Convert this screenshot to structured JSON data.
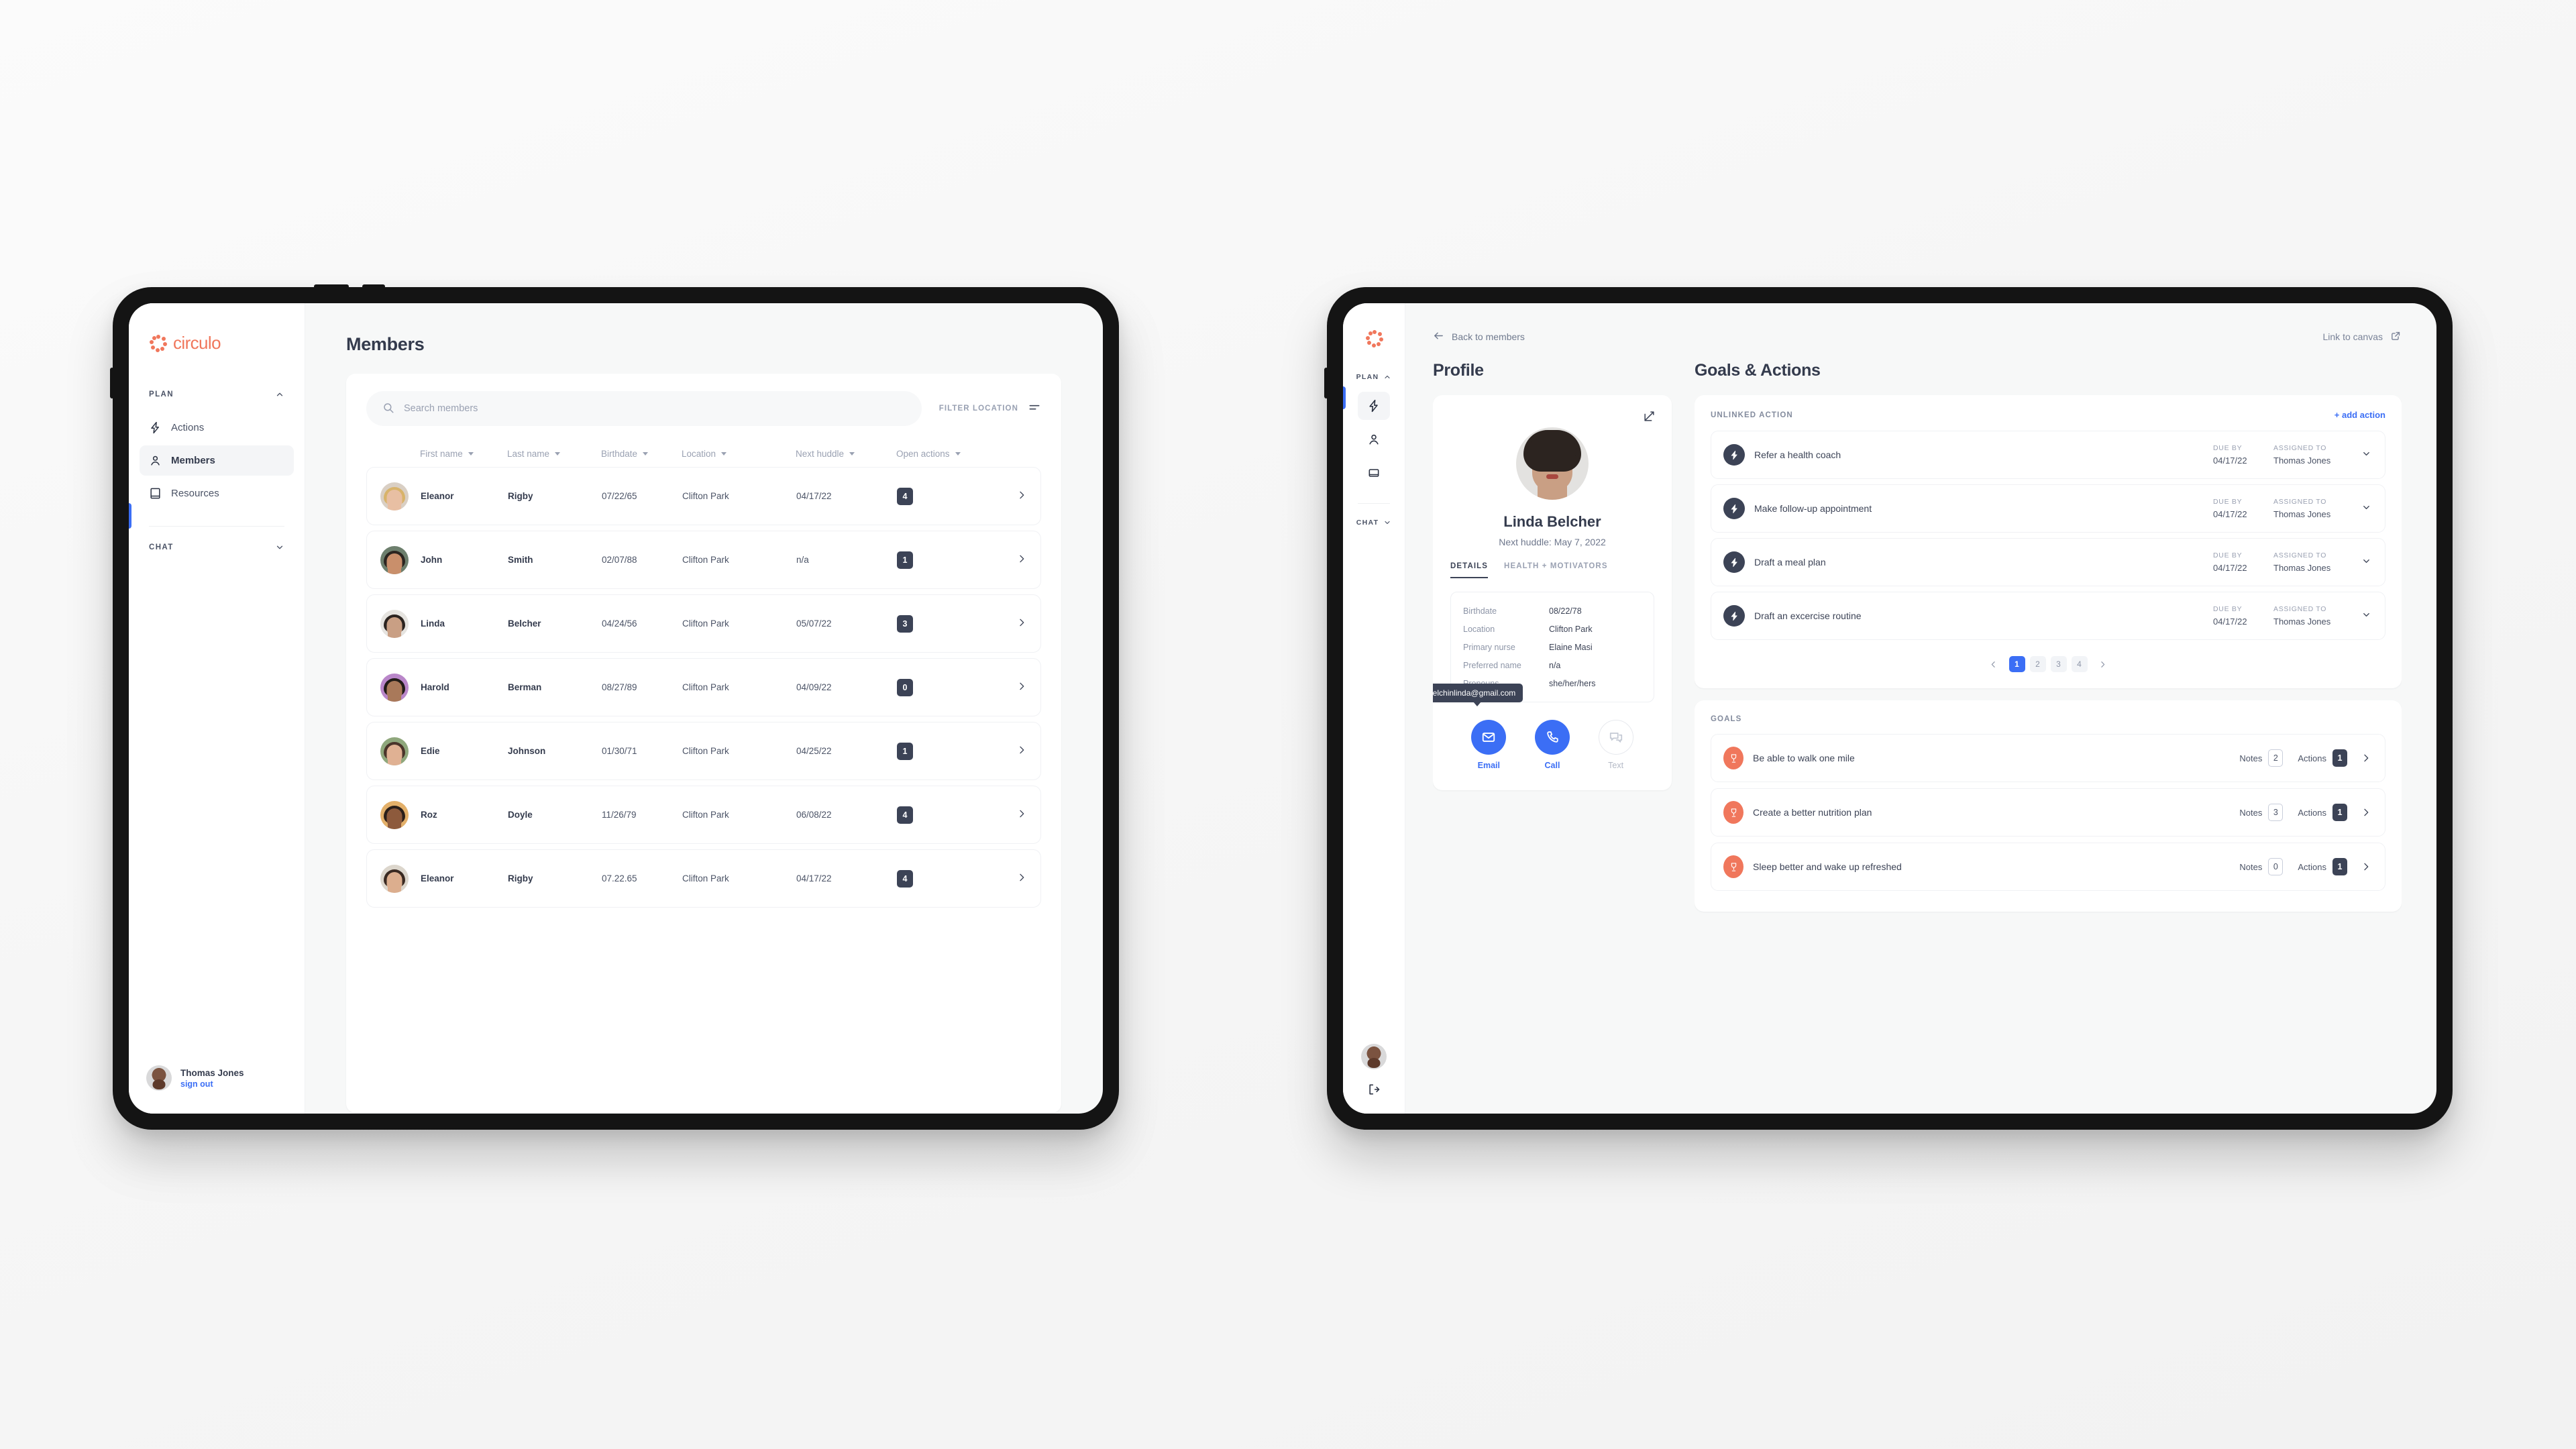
{
  "brand": {
    "word": "circulo"
  },
  "left": {
    "sidebar": {
      "plan_label": "PLAN",
      "chat_label": "CHAT",
      "items": [
        {
          "label": "Actions",
          "icon": "bolt-icon"
        },
        {
          "label": "Members",
          "icon": "user-icon"
        },
        {
          "label": "Resources",
          "icon": "book-icon"
        }
      ],
      "user": {
        "name": "Thomas Jones",
        "signout": "sign out"
      }
    },
    "page_title": "Members",
    "search": {
      "placeholder": "Search members",
      "value": ""
    },
    "filter_label": "FILTER LOCATION",
    "columns": [
      "First name",
      "Last name",
      "Birthdate",
      "Location",
      "Next huddle",
      "Open actions"
    ],
    "rows": [
      {
        "first": "Eleanor",
        "last": "Rigby",
        "birthdate": "07/22/65",
        "location": "Clifton Park",
        "huddle": "04/17/22",
        "actions": "4"
      },
      {
        "first": "John",
        "last": "Smith",
        "birthdate": "02/07/88",
        "location": "Clifton Park",
        "huddle": "n/a",
        "actions": "1"
      },
      {
        "first": "Linda",
        "last": "Belcher",
        "birthdate": "04/24/56",
        "location": "Clifton Park",
        "huddle": "05/07/22",
        "actions": "3"
      },
      {
        "first": "Harold",
        "last": "Berman",
        "birthdate": "08/27/89",
        "location": "Clifton Park",
        "huddle": "04/09/22",
        "actions": "0"
      },
      {
        "first": "Edie",
        "last": "Johnson",
        "birthdate": "01/30/71",
        "location": "Clifton Park",
        "huddle": "04/25/22",
        "actions": "1"
      },
      {
        "first": "Roz",
        "last": "Doyle",
        "birthdate": "11/26/79",
        "location": "Clifton Park",
        "huddle": "06/08/22",
        "actions": "4"
      },
      {
        "first": "Eleanor",
        "last": "Rigby",
        "birthdate": "07.22.65",
        "location": "Clifton Park",
        "huddle": "04/17/22",
        "actions": "4"
      }
    ]
  },
  "right": {
    "rail": {
      "plan_label": "PLAN",
      "chat_label": "CHAT"
    },
    "back_label": "Back to members",
    "canvas_label": "Link to canvas",
    "profile": {
      "heading": "Profile",
      "name": "Linda Belcher",
      "huddle": "Next huddle: May 7, 2022",
      "tabs": [
        {
          "label": "DETAILS"
        },
        {
          "label": "HEALTH + MOTIVATORS"
        }
      ],
      "details": [
        {
          "label": "Birthdate",
          "value": "08/22/78"
        },
        {
          "label": "Location",
          "value": "Clifton Park"
        },
        {
          "label": "Primary nurse",
          "value": "Elaine Masi"
        },
        {
          "label": "Preferred name",
          "value": "n/a"
        },
        {
          "label": "Pronouns",
          "value": "she/her/hers"
        }
      ],
      "tooltip": "belchinlinda@gmail.com",
      "contacts": [
        {
          "label": "Email",
          "icon": "envelope-icon"
        },
        {
          "label": "Call",
          "icon": "phone-icon"
        },
        {
          "label": "Text",
          "icon": "chat-bubble-icon"
        }
      ]
    },
    "goals_actions": {
      "heading": "Goals & Actions",
      "unlinked_label": "UNLINKED ACTION",
      "add_action_label": "+ add action",
      "due_by_label": "DUE BY",
      "assigned_to_label": "ASSIGNED TO",
      "actions": [
        {
          "title": "Refer a health coach",
          "due": "04/17/22",
          "assignee": "Thomas Jones"
        },
        {
          "title": "Make follow-up appointment",
          "due": "04/17/22",
          "assignee": "Thomas Jones"
        },
        {
          "title": "Draft a meal plan",
          "due": "04/17/22",
          "assignee": "Thomas Jones"
        },
        {
          "title": "Draft an excercise routine",
          "due": "04/17/22",
          "assignee": "Thomas Jones"
        }
      ],
      "pages": [
        "1",
        "2",
        "3",
        "4"
      ],
      "active_page": "1",
      "goals_label": "GOALS",
      "notes_label": "Notes",
      "actions_label": "Actions",
      "goals": [
        {
          "title": "Be able to walk one mile",
          "notes": "2",
          "actions": "1"
        },
        {
          "title": "Create a better nutrition plan",
          "notes": "3",
          "actions": "1"
        },
        {
          "title": "Sleep better and wake up refreshed",
          "notes": "0",
          "actions": "1"
        }
      ]
    }
  },
  "colors": {
    "brand": "#f0775c",
    "accent": "#3b6ef5",
    "dark": "#3c4356"
  }
}
